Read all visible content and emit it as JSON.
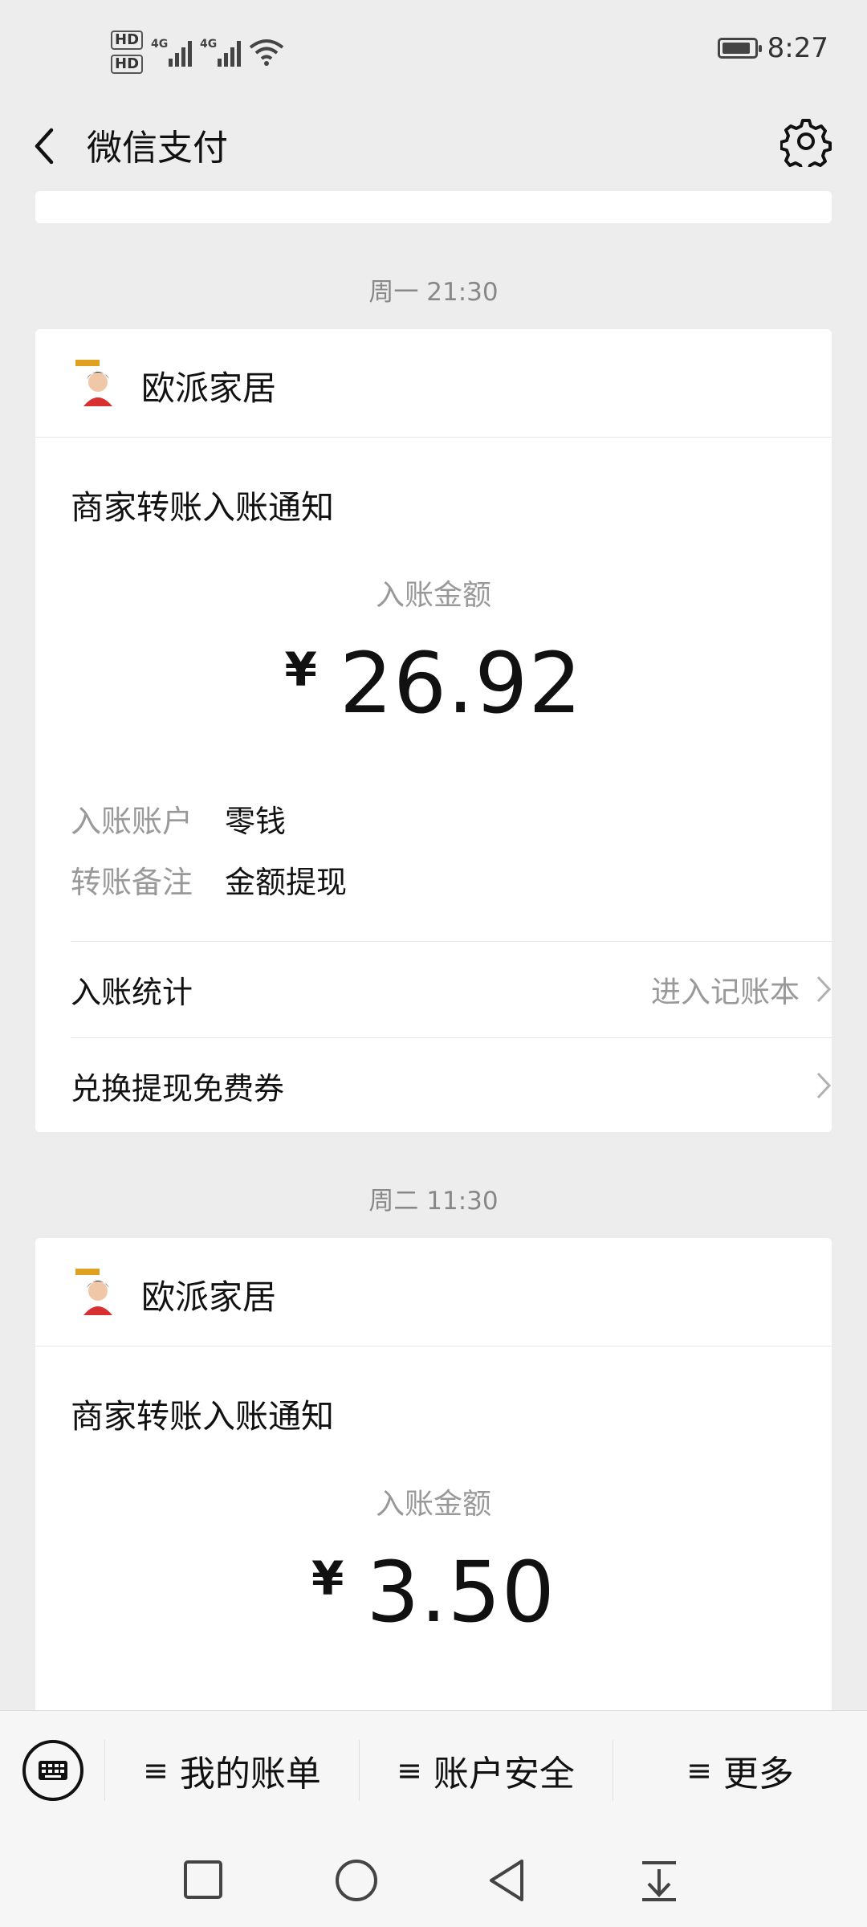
{
  "status_bar": {
    "hd1": "HD",
    "hd2": "HD",
    "net1": "4G",
    "net2": "4G",
    "time": "8:27",
    "battery_level": 0.9
  },
  "nav": {
    "title": "微信支付",
    "back_icon": "chevron-left-icon",
    "settings_icon": "gear-icon"
  },
  "messages": [
    {
      "time": "周一 21:30",
      "merchant": "欧派家居",
      "notice_title": "商家转账入账通知",
      "amount_label": "入账金额",
      "currency": "¥",
      "amount": "26.92",
      "details": [
        {
          "label": "入账账户",
          "value": "零钱"
        },
        {
          "label": "转账备注",
          "value": "金额提现"
        }
      ],
      "stats_label": "入账统计",
      "stats_link": "进入记账本",
      "coupon_label": "兑换提现免费券"
    },
    {
      "time": "周二 11:30",
      "merchant": "欧派家居",
      "notice_title": "商家转账入账通知",
      "amount_label": "入账金额",
      "currency": "¥",
      "amount": "3.50"
    }
  ],
  "bottom_menu": {
    "keyboard_icon": "keyboard-icon",
    "items": [
      "我的账单",
      "账户安全",
      "更多"
    ]
  },
  "colors": {
    "background": "#ededed",
    "card": "#ffffff",
    "muted_text": "#999999"
  }
}
